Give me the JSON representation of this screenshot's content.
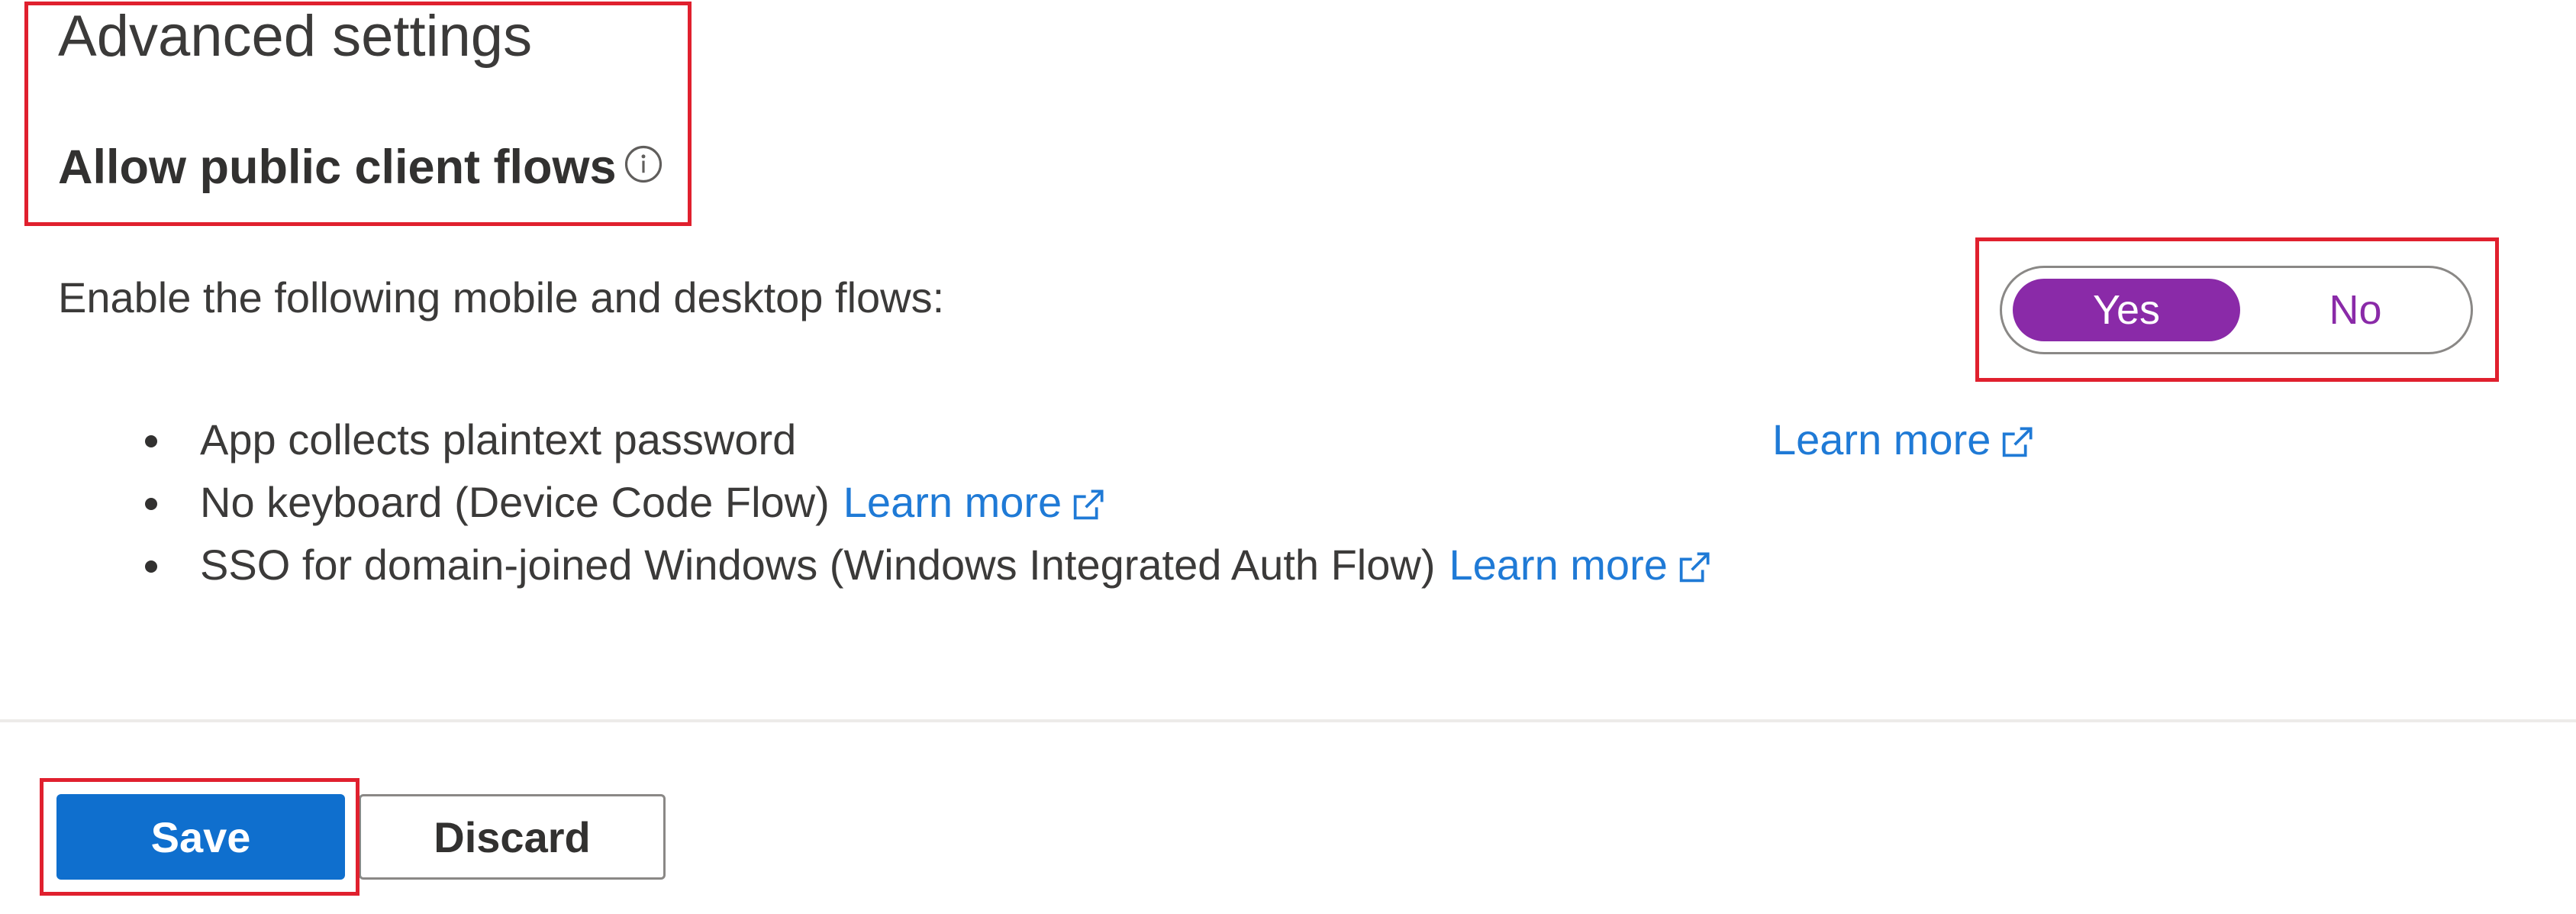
{
  "section": {
    "title": "Advanced settings",
    "setting_label": "Allow public client flows",
    "info_icon": "info-icon"
  },
  "description": "Enable the following mobile and desktop flows:",
  "toggle": {
    "yes_label": "Yes",
    "no_label": "No",
    "selected": "Yes",
    "accent_color": "#8a2aa8"
  },
  "flows": [
    {
      "text": "App collects plaintext password",
      "link": "Learn more"
    },
    {
      "text": "No keyboard (Device Code Flow)",
      "link": "Learn more"
    },
    {
      "text": "SSO for domain-joined Windows (Windows Integrated Auth Flow)",
      "link": "Learn more"
    }
  ],
  "actions": {
    "save_label": "Save",
    "discard_label": "Discard",
    "primary_color": "#0f6fce"
  },
  "link_color": "#1f7ad6",
  "highlight_color": "#e0202e"
}
